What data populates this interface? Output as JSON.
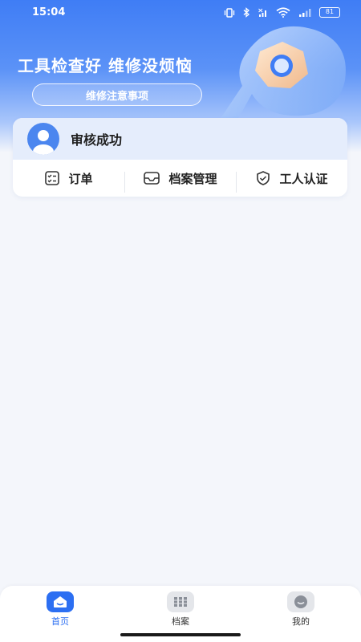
{
  "status_bar": {
    "time": "15:04",
    "battery": "81"
  },
  "banner": {
    "slogan": "工具检查好 维修没烦恼",
    "notice_button": "维修注意事项"
  },
  "card": {
    "status": "审核成功",
    "menu": [
      {
        "label": "订单",
        "icon": "order-list-icon"
      },
      {
        "label": "档案管理",
        "icon": "archive-box-icon"
      },
      {
        "label": "工人认证",
        "icon": "shield-check-icon"
      }
    ]
  },
  "tabbar": {
    "accent": "#2c6ff2",
    "tabs": [
      {
        "label": "首页",
        "icon": "home-icon",
        "active": true
      },
      {
        "label": "档案",
        "icon": "archive-icon",
        "active": false
      },
      {
        "label": "我的",
        "icon": "profile-icon",
        "active": false
      }
    ]
  }
}
